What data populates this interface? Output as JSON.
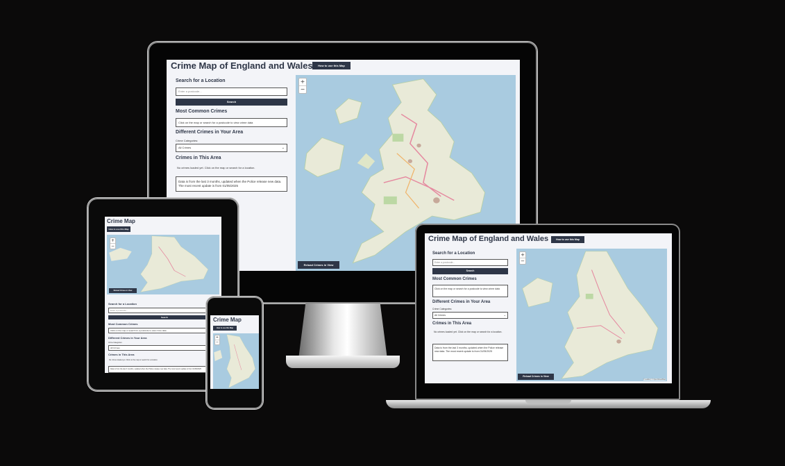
{
  "app": {
    "title": "Crime Map of England and Wales",
    "short_title": "Crime Map",
    "howto_label": "How to use this Map",
    "search_heading": "Search for a Location",
    "search_placeholder": "Enter a postcode...",
    "search_button": "Search",
    "common_heading": "Most Common Crimes",
    "common_text": "Click on the map or search for a postcode to view crime data",
    "different_heading": "Different Crimes in Your Area",
    "categories_label": "Crime Categories:",
    "categories_selected": "All Crimes",
    "area_heading": "Crimes in This Area",
    "no_crimes_text": "No crimes loaded yet. Click on the map or search for a location.",
    "info_text": "Data is from the last 3 months, updated when the Police release new data. The most recent update is from 01/05/2025",
    "reload_button": "Reload Crimes in View",
    "zoom_in": "+",
    "zoom_out": "−",
    "attribution": "© Leaflet | © OpenStreetMap"
  },
  "colors": {
    "background": "#0b0a0a",
    "brand": "#2e3647",
    "sea": "#a9cbe0",
    "land": "#e9ead8"
  }
}
